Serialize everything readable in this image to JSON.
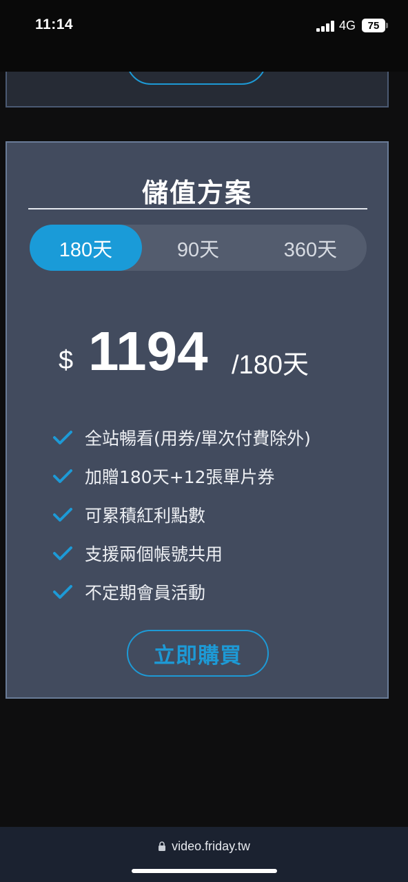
{
  "status_bar": {
    "time": "11:14",
    "network": "4G",
    "battery": "75"
  },
  "plan": {
    "title": "儲值方案",
    "tabs": [
      {
        "label": "180天",
        "active": true
      },
      {
        "label": "90天",
        "active": false
      },
      {
        "label": "360天",
        "active": false
      }
    ],
    "price": {
      "currency": "$",
      "amount": "1194",
      "period": "/180天"
    },
    "features": [
      "全站暢看(用券/單次付費除外)",
      "加贈180天+12張單片券",
      "可累積紅利點數",
      "支援兩個帳號共用",
      "不定期會員活動"
    ],
    "buy_label": "立即購買"
  },
  "browser": {
    "url": "video.friday.tw"
  },
  "colors": {
    "accent": "#1a9bd8",
    "card_bg": "#424b5e",
    "page_bg": "#0e0e0f"
  },
  "icons": {
    "check": "check-icon",
    "lock": "lock-icon"
  }
}
